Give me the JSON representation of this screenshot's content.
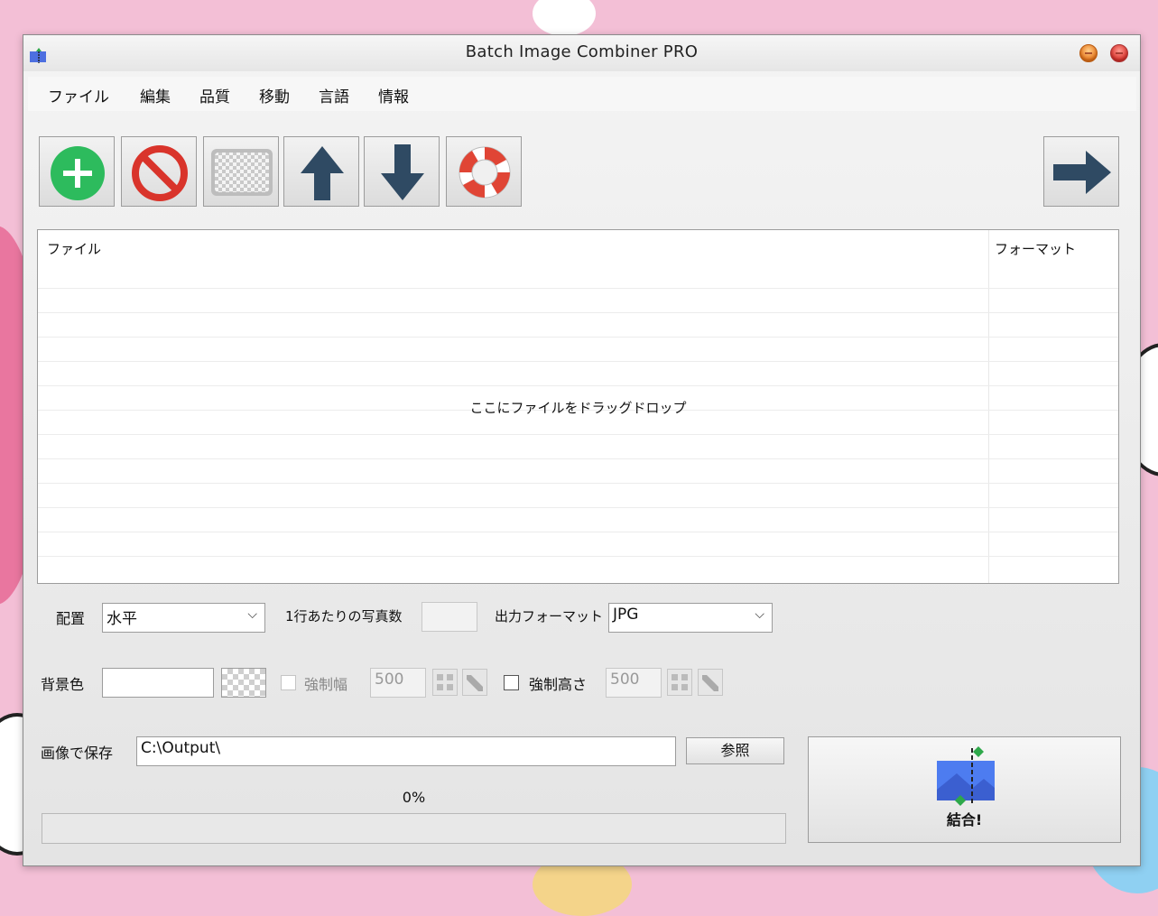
{
  "window": {
    "title": "Batch Image Combiner PRO",
    "app_icon": "app-icon"
  },
  "menu": [
    "ファイル",
    "編集",
    "品質",
    "移動",
    "言語",
    "情報"
  ],
  "toolbar": {
    "buttons": [
      {
        "name": "add-button",
        "icon": "plus-circle-icon"
      },
      {
        "name": "remove-button",
        "icon": "prohibited-icon"
      },
      {
        "name": "clear-button",
        "icon": "checkerboard-icon"
      },
      {
        "name": "move-up-button",
        "icon": "arrow-up-icon"
      },
      {
        "name": "move-down-button",
        "icon": "arrow-down-icon"
      },
      {
        "name": "help-button",
        "icon": "lifebuoy-icon"
      }
    ],
    "next_button_icon": "arrow-right-icon"
  },
  "file_list": {
    "columns": [
      "ファイル",
      "フォーマット"
    ],
    "rows": [],
    "drop_hint": "ここにファイルをドラッグドロップ"
  },
  "layout": {
    "label": "配置",
    "value": "水平",
    "per_row_label": "1行あたりの写真数",
    "per_row_value": "",
    "output_format_label": "出力フォーマット",
    "output_format_value": "JPG"
  },
  "background": {
    "label": "背景色",
    "value": "",
    "force_width": {
      "label": "強制幅",
      "checked": false,
      "enabled": false,
      "value": "500"
    },
    "force_height": {
      "label": "強制高さ",
      "checked": false,
      "enabled": true,
      "value": "500"
    }
  },
  "save": {
    "label": "画像で保存",
    "path": "C:\\Output\\",
    "browse_label": "参照"
  },
  "progress": {
    "text": "0%",
    "value": 0
  },
  "combine": {
    "label": "結合!",
    "icon": "combine-image-icon"
  },
  "colors": {
    "add": "#2dbb5d",
    "remove": "#d9342b",
    "arrow": "#2f4a63",
    "combine_blue": "#4d7cf0",
    "combine_green": "#2ea84a"
  }
}
